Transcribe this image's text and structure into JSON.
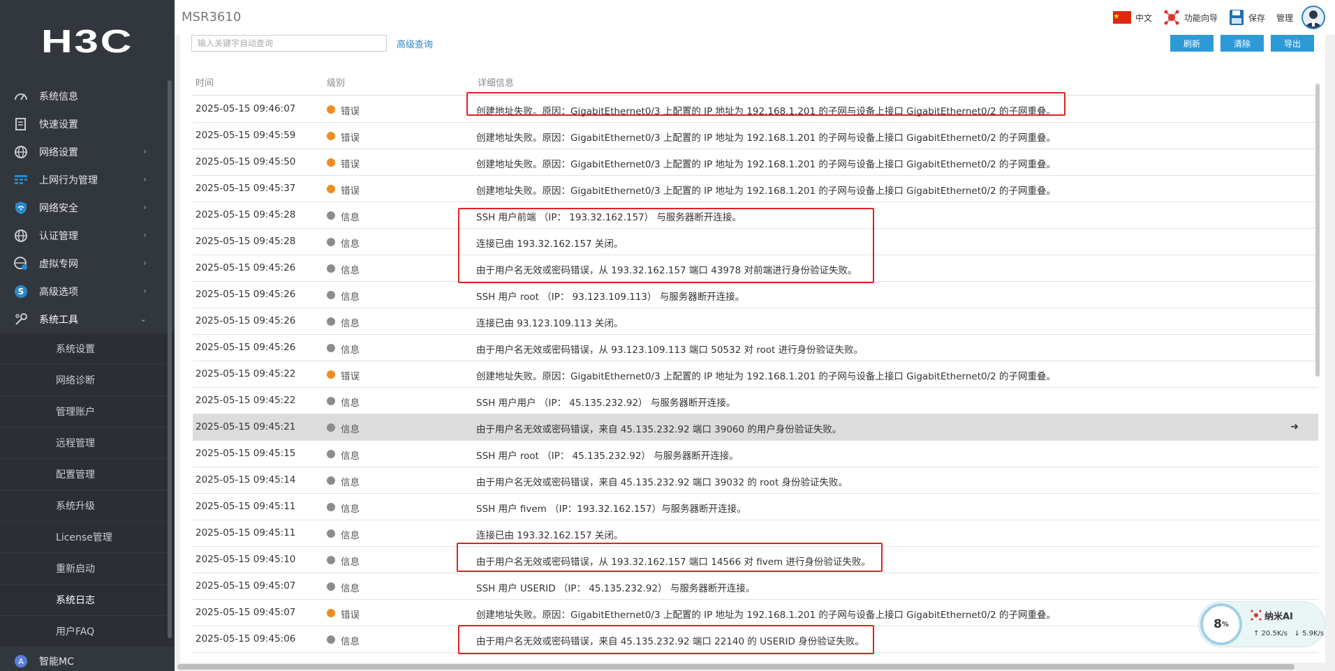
{
  "app": {
    "logo": "H3C",
    "device": "MSR3610"
  },
  "topbar": {
    "lang": "中文",
    "wizard": "功能向导",
    "save": "保存",
    "admin": "管理"
  },
  "sidebar": {
    "items": [
      {
        "label": "系统信息",
        "icon": "gauge-icon",
        "chevron": ""
      },
      {
        "label": "快速设置",
        "icon": "clipboard-icon",
        "chevron": ""
      },
      {
        "label": "网络设置",
        "icon": "globe-icon",
        "chevron": "›"
      },
      {
        "label": "上网行为管理",
        "icon": "grid-icon",
        "chevron": "›"
      },
      {
        "label": "网络安全",
        "icon": "shield-icon",
        "chevron": "›"
      },
      {
        "label": "认证管理",
        "icon": "globe-icon",
        "chevron": "›"
      },
      {
        "label": "虚拟专网",
        "icon": "vpn-globe-icon",
        "chevron": "›"
      },
      {
        "label": "高级选项",
        "icon": "s-circle-icon",
        "chevron": "›"
      },
      {
        "label": "系统工具",
        "icon": "tools-icon",
        "chevron": "⌄"
      }
    ],
    "sub_items": [
      "系统设置",
      "网络诊断",
      "管理账户",
      "远程管理",
      "配置管理",
      "系统升级",
      "License管理",
      "重新启动",
      "系统日志",
      "用户FAQ"
    ],
    "bottom_item": {
      "label": "智能MC",
      "icon": "mc-icon"
    }
  },
  "toolbar": {
    "search_placeholder": "输入关键字自动查询",
    "advanced": "高级查询",
    "refresh": "刷新",
    "clear": "清除",
    "export": "导出"
  },
  "table": {
    "headers": {
      "time": "时间",
      "level": "级别",
      "detail": "详细信息"
    },
    "level_colors": {
      "错误": "#f08c1e",
      "信息": "#8c8c8c"
    },
    "rows": [
      {
        "time": "2025-05-15 09:46:07",
        "level": "错误",
        "msg": "创建地址失败。原因：GigabitEthernet0/3 上配置的 IP 地址为 192.168.1.201 的子网与设备上接口 GigabitEthernet0/2 的子网重叠。"
      },
      {
        "time": "2025-05-15 09:45:59",
        "level": "错误",
        "msg": "创建地址失败。原因：GigabitEthernet0/3 上配置的 IP 地址为 192.168.1.201 的子网与设备上接口 GigabitEthernet0/2 的子网重叠。"
      },
      {
        "time": "2025-05-15 09:45:50",
        "level": "错误",
        "msg": "创建地址失败。原因：GigabitEthernet0/3 上配置的 IP 地址为 192.168.1.201 的子网与设备上接口 GigabitEthernet0/2 的子网重叠。"
      },
      {
        "time": "2025-05-15 09:45:37",
        "level": "错误",
        "msg": "创建地址失败。原因：GigabitEthernet0/3 上配置的 IP 地址为 192.168.1.201 的子网与设备上接口 GigabitEthernet0/2 的子网重叠。"
      },
      {
        "time": "2025-05-15 09:45:28",
        "level": "信息",
        "msg": "SSH 用户前端 （IP： 193.32.162.157） 与服务器断开连接。"
      },
      {
        "time": "2025-05-15 09:45:28",
        "level": "信息",
        "msg": "连接已由 193.32.162.157 关闭。"
      },
      {
        "time": "2025-05-15 09:45:26",
        "level": "信息",
        "msg": "由于用户名无效或密码错误，从 193.32.162.157 端口 43978 对前端进行身份验证失败。"
      },
      {
        "time": "2025-05-15 09:45:26",
        "level": "信息",
        "msg": "SSH 用户 root （IP： 93.123.109.113） 与服务器断开连接。"
      },
      {
        "time": "2025-05-15 09:45:26",
        "level": "信息",
        "msg": "连接已由 93.123.109.113 关闭。"
      },
      {
        "time": "2025-05-15 09:45:26",
        "level": "信息",
        "msg": "由于用户名无效或密码错误，从 93.123.109.113 端口 50532 对 root 进行身份验证失败。"
      },
      {
        "time": "2025-05-15 09:45:22",
        "level": "错误",
        "msg": "创建地址失败。原因：GigabitEthernet0/3 上配置的 IP 地址为 192.168.1.201 的子网与设备上接口 GigabitEthernet0/2 的子网重叠。"
      },
      {
        "time": "2025-05-15 09:45:22",
        "level": "信息",
        "msg": "SSH 用户用户 （IP： 45.135.232.92） 与服务器断开连接。"
      },
      {
        "time": "2025-05-15 09:45:21",
        "level": "信息",
        "msg": "由于用户名无效或密码错误，来自 45.135.232.92 端口 39060 的用户身份验证失败。",
        "highlight": true
      },
      {
        "time": "2025-05-15 09:45:15",
        "level": "信息",
        "msg": "SSH 用户 root （IP： 45.135.232.92） 与服务器断开连接。"
      },
      {
        "time": "2025-05-15 09:45:14",
        "level": "信息",
        "msg": "由于用户名无效或密码错误，来自 45.135.232.92 端口 39032 的 root 身份验证失败。"
      },
      {
        "time": "2025-05-15 09:45:11",
        "level": "信息",
        "msg": "SSH 用户 fivem （IP：193.32.162.157）与服务器断开连接。"
      },
      {
        "time": "2025-05-15 09:45:11",
        "level": "信息",
        "msg": "连接已由 193.32.162.157 关闭。"
      },
      {
        "time": "2025-05-15 09:45:10",
        "level": "信息",
        "msg": "由于用户名无效或密码错误，从 193.32.162.157 端口 14566 对 fivem 进行身份验证失败。"
      },
      {
        "time": "2025-05-15 09:45:07",
        "level": "信息",
        "msg": "SSH 用户 USERID （IP： 45.135.232.92） 与服务器断开连接。"
      },
      {
        "time": "2025-05-15 09:45:07",
        "level": "错误",
        "msg": "创建地址失败。原因：GigabitEthernet0/3 上配置的 IP 地址为 192.168.1.201 的子网与设备上接口 GigabitEthernet0/2 的子网重叠。"
      },
      {
        "time": "2025-05-15 09:45:06",
        "level": "信息",
        "msg": "由于用户名无效或密码错误，来自 45.135.232.92 端口 22140 的 USERID 身份验证失败。"
      }
    ]
  },
  "widget": {
    "percent": "8",
    "percent_unit": "%",
    "name": "纳米AI",
    "up": "↑ 20.5K/s",
    "down": "↓ 5.9K/s"
  }
}
